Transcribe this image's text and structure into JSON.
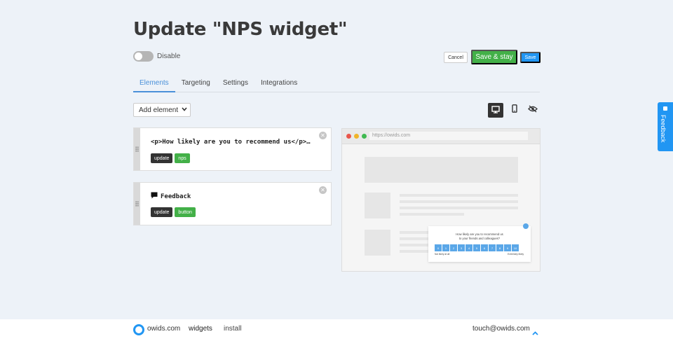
{
  "page": {
    "title": "Update \"NPS widget\""
  },
  "status": {
    "toggle_label": "Disable",
    "enabled": false
  },
  "actions": {
    "cancel": "Cancel",
    "save_stay": "Save & stay",
    "save": "Save"
  },
  "tabs": [
    {
      "label": "Elements",
      "active": true
    },
    {
      "label": "Targeting",
      "active": false
    },
    {
      "label": "Settings",
      "active": false
    },
    {
      "label": "Integrations",
      "active": false
    }
  ],
  "add_element": {
    "label": "Add element"
  },
  "view_modes": [
    "desktop-icon",
    "mobile-icon",
    "eye-off-icon"
  ],
  "elements": [
    {
      "title": "<p>How likely are you to recommend us</p>…",
      "tags": [
        "update",
        "nps"
      ]
    },
    {
      "title": "Feedback",
      "icon": "message-icon",
      "tags": [
        "update",
        "button"
      ]
    }
  ],
  "preview": {
    "url": "https://owids.com",
    "nps": {
      "question_line1": "How likely are you to recommend us",
      "question_line2": "to your friends and colleagues?",
      "scale": [
        "0",
        "1",
        "2",
        "3",
        "4",
        "5",
        "6",
        "7",
        "8",
        "9",
        "10"
      ],
      "left_label": "Not likely at all",
      "right_label": "Extremely likely"
    }
  },
  "feedback_tab": {
    "label": "Feedback"
  },
  "footer": {
    "brand": "owids.com",
    "links": [
      "widgets",
      "install"
    ],
    "email": "touch@owids.com"
  },
  "colors": {
    "primary": "#2196f3",
    "success": "#43b048",
    "dark": "#333333",
    "background": "#edf2f8"
  }
}
